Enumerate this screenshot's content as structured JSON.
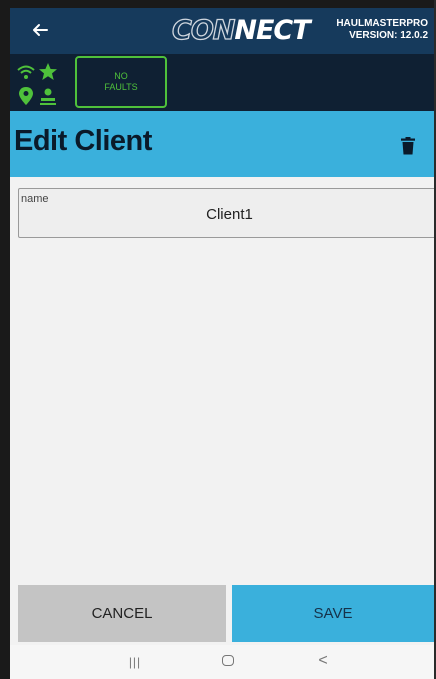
{
  "header": {
    "back_icon": "arrow-left-icon",
    "logo_part1": "CON",
    "logo_part2": "NECT",
    "product_name": "HAULMASTERPRO",
    "version": "VERSION: 12.0.2"
  },
  "status": {
    "icons": [
      "wifi-icon",
      "star-icon",
      "location-pin-icon",
      "user-icon"
    ],
    "status_color": "#4fc13b",
    "faults_line1": "NO",
    "faults_line2": "FAULTS"
  },
  "page": {
    "title": "Edit Client",
    "delete_icon": "trash-icon",
    "title_bar_color": "#3ab0dc"
  },
  "form": {
    "name_label": "name",
    "name_value": "Client1"
  },
  "actions": {
    "cancel_label": "CANCEL",
    "save_label": "SAVE"
  },
  "system_nav": {
    "recents_glyph": "|||",
    "back_glyph": "<"
  }
}
